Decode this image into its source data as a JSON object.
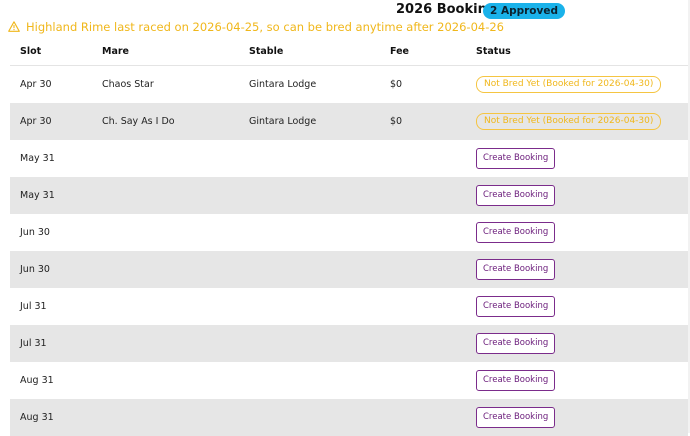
{
  "header": {
    "title": "2026 Bookings",
    "approved_badge": "2 Approved"
  },
  "warning": {
    "icon": "warning-triangle-icon",
    "text": "Highland Rime last raced on 2026-04-25, so can be bred anytime after 2026-04-26"
  },
  "table": {
    "columns": [
      "Slot",
      "Mare",
      "Stable",
      "Fee",
      "Status"
    ],
    "rows": [
      {
        "slot": "Apr 30",
        "mare": "Chaos Star",
        "stable": "Gintara Lodge",
        "fee": "$0",
        "status": "Not Bred Yet (Booked for 2026-04-30)",
        "type": "pill"
      },
      {
        "slot": "Apr 30",
        "mare": "Ch. Say As I Do",
        "stable": "Gintara Lodge",
        "fee": "$0",
        "status": "Not Bred Yet (Booked for 2026-04-30)",
        "type": "pill"
      },
      {
        "slot": "May 31",
        "mare": "",
        "stable": "",
        "fee": "",
        "status": "Create Booking",
        "type": "button"
      },
      {
        "slot": "May 31",
        "mare": "",
        "stable": "",
        "fee": "",
        "status": "Create Booking",
        "type": "button"
      },
      {
        "slot": "Jun 30",
        "mare": "",
        "stable": "",
        "fee": "",
        "status": "Create Booking",
        "type": "button"
      },
      {
        "slot": "Jun 30",
        "mare": "",
        "stable": "",
        "fee": "",
        "status": "Create Booking",
        "type": "button"
      },
      {
        "slot": "Jul 31",
        "mare": "",
        "stable": "",
        "fee": "",
        "status": "Create Booking",
        "type": "button"
      },
      {
        "slot": "Jul 31",
        "mare": "",
        "stable": "",
        "fee": "",
        "status": "Create Booking",
        "type": "button"
      },
      {
        "slot": "Aug 31",
        "mare": "",
        "stable": "",
        "fee": "",
        "status": "Create Booking",
        "type": "button"
      },
      {
        "slot": "Aug 31",
        "mare": "",
        "stable": "",
        "fee": "",
        "status": "Create Booking",
        "type": "button"
      }
    ]
  },
  "colors": {
    "warning": "#f0b71b",
    "badge": "#1ab2ea",
    "button_border": "#7b2c8b",
    "row_shade": "#e6e6e6"
  }
}
